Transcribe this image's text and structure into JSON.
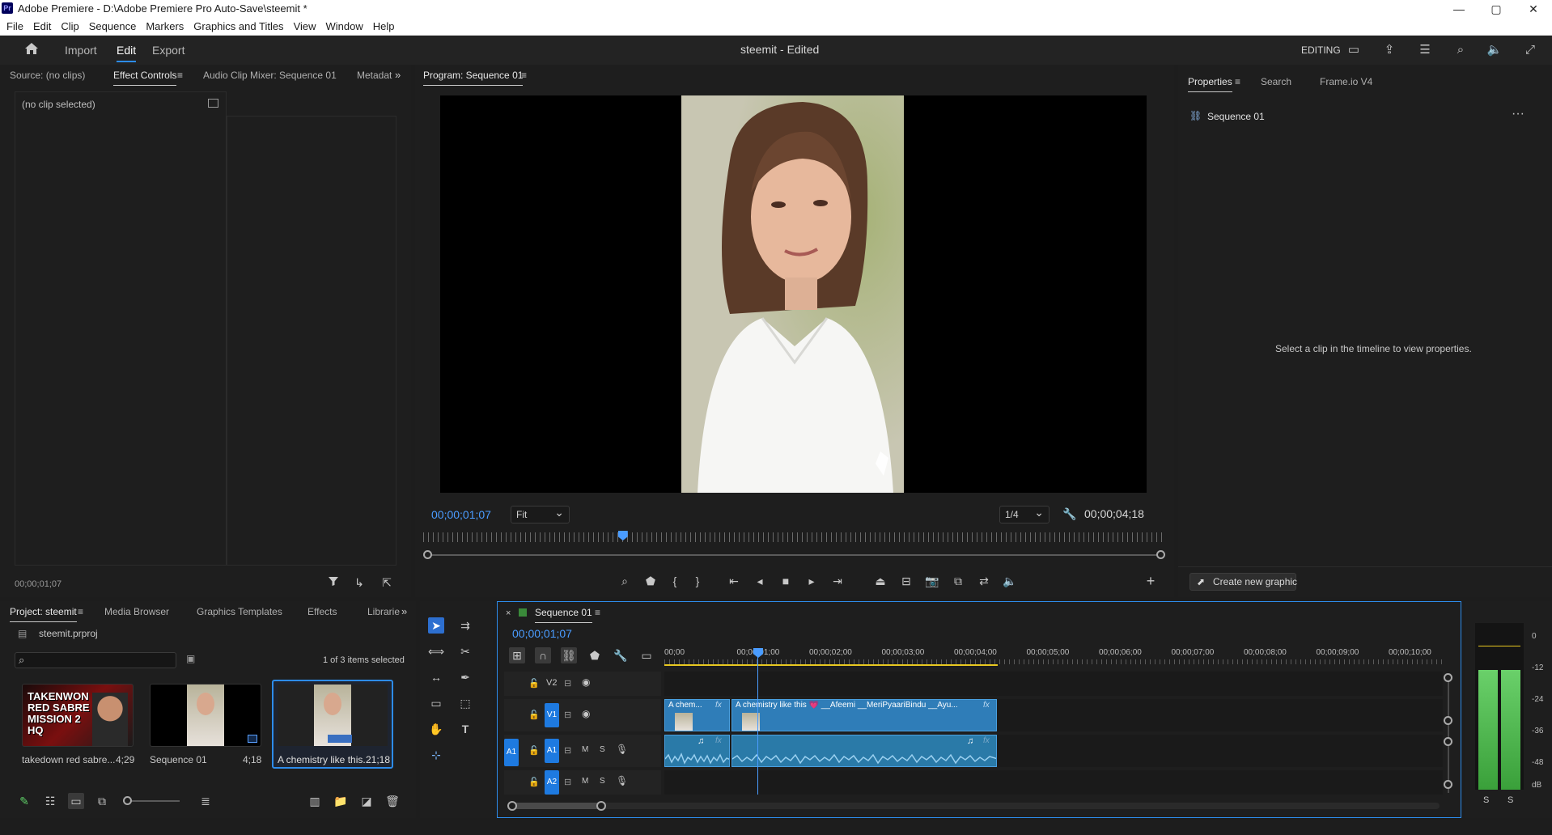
{
  "titlebar": {
    "app_logo": "Pr",
    "title": "Adobe Premiere - D:\\Adobe Premiere Pro Auto-Save\\steemit *",
    "minimize": "—",
    "maximize": "▢",
    "close": "✕"
  },
  "menu": [
    "File",
    "Edit",
    "Clip",
    "Sequence",
    "Markers",
    "Graphics and Titles",
    "View",
    "Window",
    "Help"
  ],
  "header": {
    "tabs": [
      "Import",
      "Edit",
      "Export"
    ],
    "active_tab": "Edit",
    "project_title": "steemit - Edited",
    "workspace_label": "EDITING"
  },
  "source_panel": {
    "tabs": [
      "Source: (no clips)",
      "Effect Controls",
      "Audio Clip Mixer: Sequence 01",
      "Metadat"
    ],
    "empty_text": "(no clip selected)",
    "timecode": "00;00;01;07"
  },
  "program_monitor": {
    "tab": "Program: Sequence 01",
    "current_timecode": "00;00;01;07",
    "fit": "Fit",
    "resolution": "1/4",
    "duration": "00;00;04;18",
    "playhead_fraction": 0.27
  },
  "properties_panel": {
    "tabs": [
      "Properties",
      "Search",
      "Frame.io V4"
    ],
    "sequence_name": "Sequence 01",
    "hint": "Select a clip in the timeline to view properties.",
    "create_graphic": "Create new graphic"
  },
  "project_panel": {
    "tabs": [
      "Project: steemit",
      "Media Browser",
      "Graphics Templates",
      "Effects",
      "Librarie"
    ],
    "file_name": "steemit.prproj",
    "selection_status": "1 of 3 items selected",
    "items": [
      {
        "name": "takedown red sabre...",
        "duration": "4;29",
        "thumb_text": "TAKENWON RED SABRE MISSION 2 HQ"
      },
      {
        "name": "Sequence 01",
        "duration": "4;18"
      },
      {
        "name": "A chemistry like this...",
        "duration": "21;18"
      }
    ]
  },
  "timeline": {
    "sequence_tab": "Sequence 01",
    "timecode": "00;00;01;07",
    "ruler": [
      "00;00",
      "00;00;01;00",
      "00;00;02;00",
      "00;00;03;00",
      "00;00;04;00",
      "00;00;05;00",
      "00;00;06;00",
      "00;00;07;00",
      "00;00;08;00",
      "00;00;09;00",
      "00;00;10;00"
    ],
    "tracks": {
      "v2": "V2",
      "v1": "V1",
      "a1": "A1",
      "a2": "A2",
      "src_a1": "A1",
      "m": "M",
      "s": "S"
    },
    "clips": {
      "v1_clip1": "A chem...",
      "v1_clip2": "A chemistry like this 💗 __Afeemi __MeriPyaariBindu __Ayu...",
      "fx": "fx"
    }
  },
  "audio_meter": {
    "labels": [
      "0",
      "-12",
      "-24",
      "-36",
      "-48",
      "dB"
    ],
    "channels": [
      "S",
      "S"
    ],
    "level_left": 0.72,
    "level_right": 0.72
  }
}
